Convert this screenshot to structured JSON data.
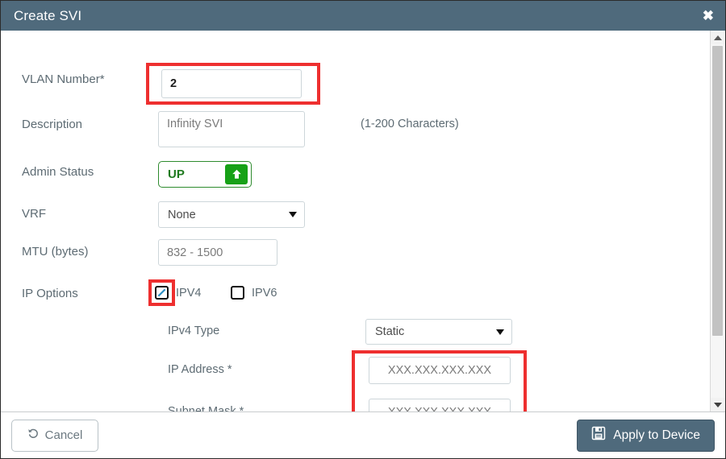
{
  "window": {
    "title": "Create SVI",
    "close_icon": "close-icon"
  },
  "form": {
    "vlan_number": {
      "label": "VLAN Number*",
      "value": "2",
      "placeholder": ""
    },
    "description": {
      "label": "Description",
      "value": "",
      "placeholder": "Infinity SVI",
      "hint": "(1-200 Characters)"
    },
    "admin_status": {
      "label": "Admin Status",
      "value": "UP",
      "icon": "arrow-up-icon"
    },
    "vrf": {
      "label": "VRF",
      "value": "None",
      "caret_icon": "chevron-down-icon"
    },
    "mtu": {
      "label": "MTU (bytes)",
      "value": "",
      "placeholder": "832 - 1500"
    },
    "ip_options": {
      "label": "IP Options",
      "choices": [
        {
          "label": "IPV4",
          "checked": true
        },
        {
          "label": "IPV6",
          "checked": false
        }
      ]
    },
    "ipv4_type": {
      "label": "IPv4 Type",
      "value": "Static",
      "caret_icon": "chevron-down-icon"
    },
    "ip_address": {
      "label": "IP Address *",
      "value": "",
      "placeholder": "XXX.XXX.XXX.XXX"
    },
    "subnet_mask": {
      "label": "Subnet Mask *",
      "value": "",
      "placeholder": "XXX.XXX.XXX.XXX"
    }
  },
  "footer": {
    "cancel_label": "Cancel",
    "cancel_icon": "undo-icon",
    "apply_label": "Apply to Device",
    "apply_icon": "save-icon"
  },
  "scrollbar": {
    "up_icon": "scroll-up-arrow-icon",
    "down_icon": "scroll-down-arrow-icon"
  },
  "colors": {
    "header": "#4f6a7c",
    "accent_green": "#17a117",
    "annotation_red": "#ee2f2f",
    "label_gray": "#5d6b73"
  }
}
